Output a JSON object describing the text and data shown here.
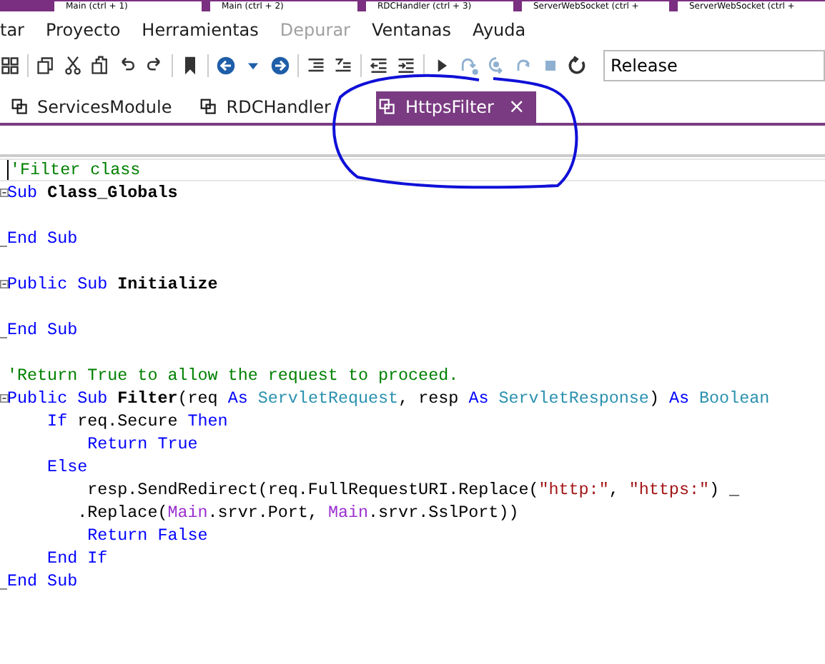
{
  "top_buttons": [
    "Main  (ctrl + 1)",
    "Main  (ctrl + 2)",
    "RDCHandler  (ctrl + 3)",
    "ServerWebSocket  (ctrl +",
    "ServerWebSocket  (ctrl +"
  ],
  "menu": [
    {
      "label": "tar",
      "disabled": false
    },
    {
      "label": "Proyecto",
      "disabled": false
    },
    {
      "label": "Herramientas",
      "disabled": false
    },
    {
      "label": "Depurar",
      "disabled": true
    },
    {
      "label": "Ventanas",
      "disabled": false
    },
    {
      "label": "Ayuda",
      "disabled": false
    }
  ],
  "toolbar": [
    {
      "kind": "grid",
      "disabled": false
    },
    {
      "kind": "sep"
    },
    {
      "kind": "copy",
      "disabled": false
    },
    {
      "kind": "cut",
      "disabled": false
    },
    {
      "kind": "paste",
      "disabled": false
    },
    {
      "kind": "undo",
      "disabled": false
    },
    {
      "kind": "redo",
      "disabled": false
    },
    {
      "kind": "sep"
    },
    {
      "kind": "bookmark",
      "disabled": false
    },
    {
      "kind": "sep"
    },
    {
      "kind": "back",
      "disabled": false
    },
    {
      "kind": "caret",
      "disabled": false
    },
    {
      "kind": "forward",
      "disabled": false
    },
    {
      "kind": "sep"
    },
    {
      "kind": "lines",
      "disabled": false
    },
    {
      "kind": "comment",
      "disabled": false
    },
    {
      "kind": "sep"
    },
    {
      "kind": "outdent",
      "disabled": false
    },
    {
      "kind": "indent",
      "disabled": false
    },
    {
      "kind": "sep"
    },
    {
      "kind": "run",
      "disabled": false
    },
    {
      "kind": "stepover",
      "disabled": true
    },
    {
      "kind": "stepin",
      "disabled": true
    },
    {
      "kind": "stepout",
      "disabled": true
    },
    {
      "kind": "stop",
      "disabled": true
    },
    {
      "kind": "restart",
      "disabled": false
    }
  ],
  "build_config": {
    "value": "Release"
  },
  "tabs": [
    {
      "label": "ServicesModule",
      "selected": false
    },
    {
      "label": "RDCHandler",
      "selected": false
    },
    {
      "label": "HttpsFilter",
      "selected": true,
      "close": "×"
    }
  ],
  "code_lines": [
    {
      "kind": "code",
      "current": true,
      "tokens": [
        {
          "kind": "comment",
          "text": "'Filter class"
        }
      ]
    },
    {
      "kind": "fold_start",
      "tokens": [
        {
          "kind": "kw",
          "text": "Sub "
        },
        {
          "kind": "name",
          "text": "Class_Globals"
        }
      ]
    },
    {
      "kind": "blank"
    },
    {
      "kind": "fold_end",
      "tokens": [
        {
          "kind": "kw",
          "text": "End Sub"
        }
      ]
    },
    {
      "kind": "blank"
    },
    {
      "kind": "fold_start",
      "tokens": [
        {
          "kind": "kw",
          "text": "Public Sub "
        },
        {
          "kind": "name",
          "text": "Initialize"
        }
      ]
    },
    {
      "kind": "blank"
    },
    {
      "kind": "fold_end",
      "tokens": [
        {
          "kind": "kw",
          "text": "End Sub"
        }
      ]
    },
    {
      "kind": "blank"
    },
    {
      "kind": "code",
      "tokens": [
        {
          "kind": "comment",
          "text": "'Return True to allow the request to proceed."
        }
      ]
    },
    {
      "kind": "fold_start",
      "tokens": [
        {
          "kind": "kw",
          "text": "Public Sub "
        },
        {
          "kind": "name",
          "text": "Filter"
        },
        {
          "kind": "plain",
          "text": "(req "
        },
        {
          "kind": "kw",
          "text": "As "
        },
        {
          "kind": "type",
          "text": "ServletRequest"
        },
        {
          "kind": "plain",
          "text": ", resp "
        },
        {
          "kind": "kw",
          "text": "As "
        },
        {
          "kind": "type",
          "text": "ServletResponse"
        },
        {
          "kind": "plain",
          "text": ") "
        },
        {
          "kind": "kw",
          "text": "As "
        },
        {
          "kind": "type",
          "text": "Boolean"
        }
      ]
    },
    {
      "kind": "code",
      "tokens": [
        {
          "kind": "kw",
          "text": "    If"
        },
        {
          "kind": "plain",
          "text": " req.Secure "
        },
        {
          "kind": "kw",
          "text": "Then"
        }
      ]
    },
    {
      "kind": "code",
      "tokens": [
        {
          "kind": "kw",
          "text": "        Return True"
        }
      ]
    },
    {
      "kind": "code",
      "tokens": [
        {
          "kind": "kw",
          "text": "    Else"
        }
      ]
    },
    {
      "kind": "code",
      "tokens": [
        {
          "kind": "plain",
          "text": "        resp.SendRedirect(req.FullRequestURI.Replace("
        },
        {
          "kind": "str",
          "text": "\"http:\""
        },
        {
          "kind": "plain",
          "text": ", "
        },
        {
          "kind": "str",
          "text": "\"https:\""
        },
        {
          "kind": "plain",
          "text": ") _"
        }
      ]
    },
    {
      "kind": "code",
      "tokens": [
        {
          "kind": "plain",
          "text": "       .Replace("
        },
        {
          "kind": "module",
          "text": "Main"
        },
        {
          "kind": "plain",
          "text": ".srvr.Port, "
        },
        {
          "kind": "module",
          "text": "Main"
        },
        {
          "kind": "plain",
          "text": ".srvr.SslPort))"
        }
      ]
    },
    {
      "kind": "code",
      "tokens": [
        {
          "kind": "kw",
          "text": "        Return False"
        }
      ]
    },
    {
      "kind": "code",
      "tokens": [
        {
          "kind": "kw",
          "text": "    End If"
        }
      ]
    },
    {
      "kind": "fold_end",
      "tokens": [
        {
          "kind": "kw",
          "text": "End Sub"
        }
      ]
    }
  ]
}
